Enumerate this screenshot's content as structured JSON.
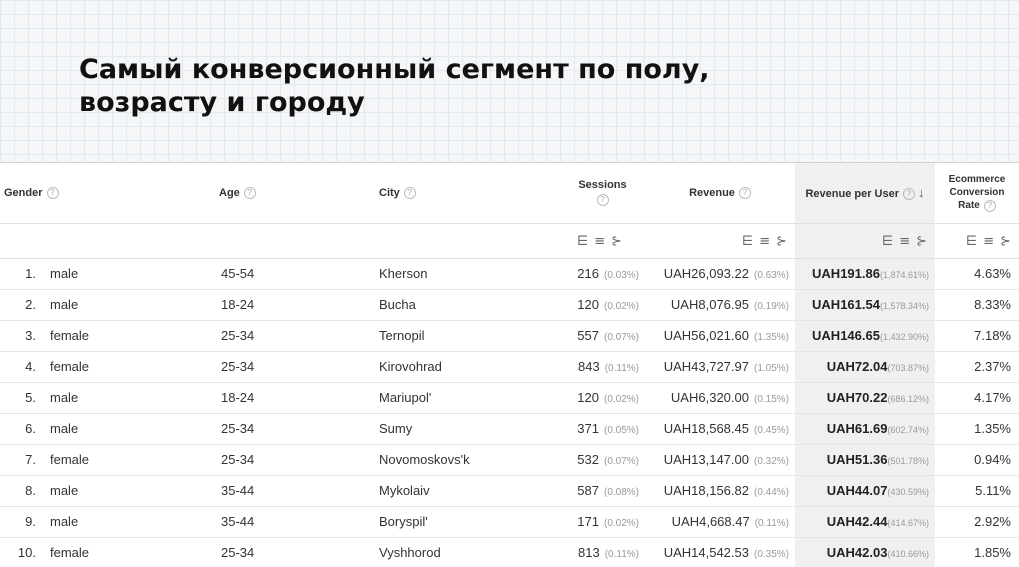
{
  "slide": {
    "title": "Самый конверсионный сегмент по полу,\nвозрасту и городу"
  },
  "table": {
    "headers": {
      "gender": "Gender",
      "age": "Age",
      "city": "City",
      "sessions": "Sessions",
      "revenue": "Revenue",
      "revenue_per_user": "Revenue per User",
      "ecr_line1": "Ecommerce",
      "ecr_line2": "Conversion",
      "ecr_line3": "Rate"
    },
    "help_glyph": "?",
    "sort_glyph": "↓",
    "control_glyphs": "⋿≡⊱",
    "rows": [
      {
        "index": "1.",
        "gender": "male",
        "age": "45-54",
        "city": "Kherson",
        "sessions": "216",
        "sessions_pct": "(0.03%)",
        "revenue": "UAH26,093.22",
        "revenue_pct": "(0.63%)",
        "rpu": "UAH191.86",
        "rpu_pct": "(1,874.61%)",
        "ecr": "4.63%"
      },
      {
        "index": "2.",
        "gender": "male",
        "age": "18-24",
        "city": "Bucha",
        "sessions": "120",
        "sessions_pct": "(0.02%)",
        "revenue": "UAH8,076.95",
        "revenue_pct": "(0.19%)",
        "rpu": "UAH161.54",
        "rpu_pct": "(1,578.34%)",
        "ecr": "8.33%"
      },
      {
        "index": "3.",
        "gender": "female",
        "age": "25-34",
        "city": "Ternopil",
        "sessions": "557",
        "sessions_pct": "(0.07%)",
        "revenue": "UAH56,021.60",
        "revenue_pct": "(1.35%)",
        "rpu": "UAH146.65",
        "rpu_pct": "(1,432.90%)",
        "ecr": "7.18%"
      },
      {
        "index": "4.",
        "gender": "female",
        "age": "25-34",
        "city": "Kirovohrad",
        "sessions": "843",
        "sessions_pct": "(0.11%)",
        "revenue": "UAH43,727.97",
        "revenue_pct": "(1.05%)",
        "rpu": "UAH72.04",
        "rpu_pct": "(703.87%)",
        "ecr": "2.37%"
      },
      {
        "index": "5.",
        "gender": "male",
        "age": "18-24",
        "city": "Mariupol'",
        "sessions": "120",
        "sessions_pct": "(0.02%)",
        "revenue": "UAH6,320.00",
        "revenue_pct": "(0.15%)",
        "rpu": "UAH70.22",
        "rpu_pct": "(686.12%)",
        "ecr": "4.17%"
      },
      {
        "index": "6.",
        "gender": "male",
        "age": "25-34",
        "city": "Sumy",
        "sessions": "371",
        "sessions_pct": "(0.05%)",
        "revenue": "UAH18,568.45",
        "revenue_pct": "(0.45%)",
        "rpu": "UAH61.69",
        "rpu_pct": "(602.74%)",
        "ecr": "1.35%"
      },
      {
        "index": "7.",
        "gender": "female",
        "age": "25-34",
        "city": "Novomoskovs'k",
        "sessions": "532",
        "sessions_pct": "(0.07%)",
        "revenue": "UAH13,147.00",
        "revenue_pct": "(0.32%)",
        "rpu": "UAH51.36",
        "rpu_pct": "(501.78%)",
        "ecr": "0.94%"
      },
      {
        "index": "8.",
        "gender": "male",
        "age": "35-44",
        "city": "Mykolaiv",
        "sessions": "587",
        "sessions_pct": "(0.08%)",
        "revenue": "UAH18,156.82",
        "revenue_pct": "(0.44%)",
        "rpu": "UAH44.07",
        "rpu_pct": "(430.59%)",
        "ecr": "5.11%"
      },
      {
        "index": "9.",
        "gender": "male",
        "age": "35-44",
        "city": "Boryspil'",
        "sessions": "171",
        "sessions_pct": "(0.02%)",
        "revenue": "UAH4,668.47",
        "revenue_pct": "(0.11%)",
        "rpu": "UAH42.44",
        "rpu_pct": "(414.67%)",
        "ecr": "2.92%"
      },
      {
        "index": "10.",
        "gender": "female",
        "age": "25-34",
        "city": "Vyshhorod",
        "sessions": "813",
        "sessions_pct": "(0.11%)",
        "revenue": "UAH14,542.53",
        "revenue_pct": "(0.35%)",
        "rpu": "UAH42.03",
        "rpu_pct": "(410.66%)",
        "ecr": "1.85%"
      }
    ]
  }
}
